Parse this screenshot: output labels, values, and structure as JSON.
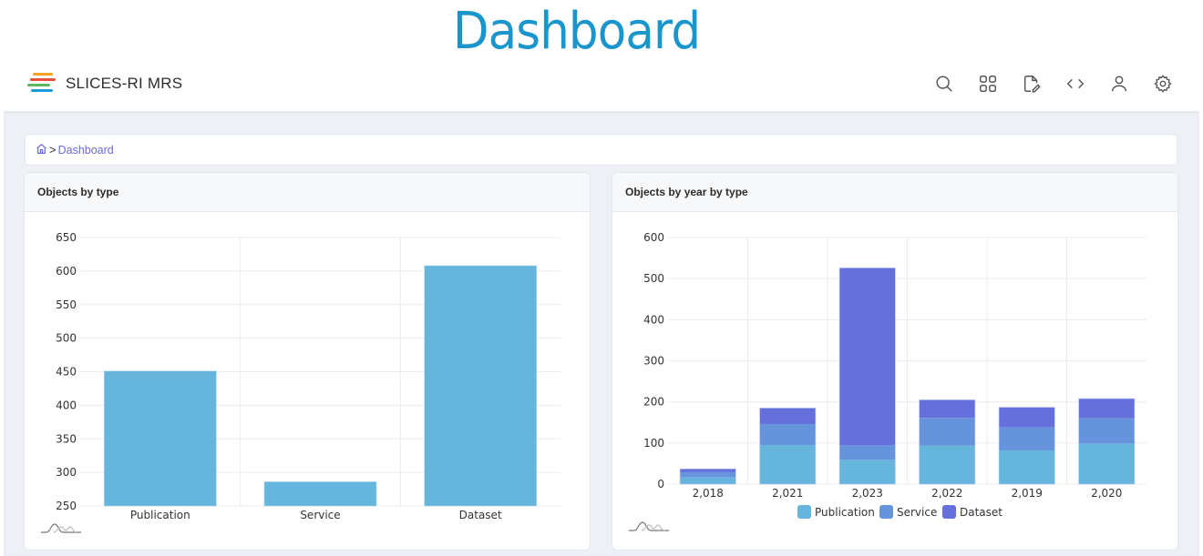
{
  "page_title": "Dashboard",
  "navbar": {
    "brand": "SLICES-RI MRS",
    "logo_colors": [
      "#f5a623",
      "#e8503a",
      "#5cb85c",
      "#1e9bd7"
    ],
    "icons": [
      "search-icon",
      "apps-grid-icon",
      "edit-document-icon",
      "code-icon",
      "user-icon",
      "settings-gear-icon"
    ]
  },
  "breadcrumb": {
    "home_icon": "home-icon",
    "separator": ">",
    "current": "Dashboard"
  },
  "colors": {
    "publication": "#66b5dc",
    "service": "#6694dc",
    "dataset": "#6670dc",
    "single_bar": "#66b5dc"
  },
  "chart_data": [
    {
      "type": "bar",
      "title": "Objects by type",
      "categories": [
        "Publication",
        "Service",
        "Dataset"
      ],
      "values": [
        451,
        286,
        608
      ],
      "xlabel": "",
      "ylabel": "",
      "ylim": [
        250,
        650
      ],
      "yticks": [
        250,
        300,
        350,
        400,
        450,
        500,
        550,
        600,
        650
      ],
      "grid": true,
      "legend": "none"
    },
    {
      "type": "bar",
      "stacked": true,
      "title": "Objects by year by type",
      "categories": [
        "2,018",
        "2,021",
        "2,023",
        "2,022",
        "2,019",
        "2,020"
      ],
      "series": [
        {
          "name": "Publication",
          "values": [
            16,
            95,
            59,
            94,
            82,
            98
          ]
        },
        {
          "name": "Service",
          "values": [
            13,
            51,
            36,
            67,
            56,
            62
          ]
        },
        {
          "name": "Dataset",
          "values": [
            8,
            39,
            431,
            44,
            49,
            48
          ]
        }
      ],
      "xlabel": "",
      "ylabel": "",
      "ylim": [
        0,
        600
      ],
      "yticks": [
        0,
        100,
        200,
        300,
        400,
        500,
        600
      ],
      "grid": true,
      "legend": "bottom"
    }
  ]
}
